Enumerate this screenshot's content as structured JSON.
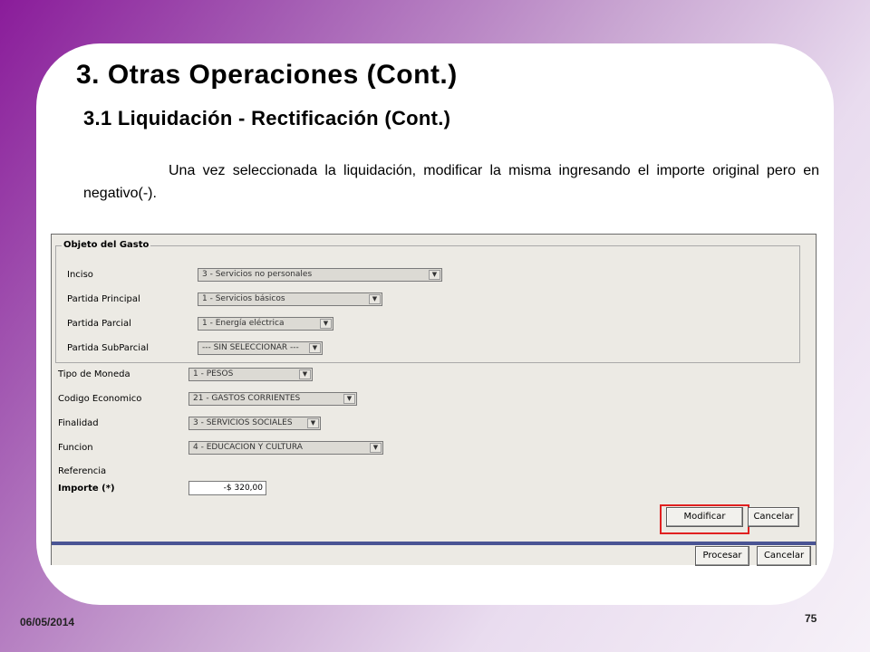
{
  "slide": {
    "title": "3. Otras Operaciones (Cont.)",
    "subtitle": "3.1 Liquidación - Rectificación (Cont.)",
    "paragraph": "Una vez seleccionada la liquidación, modificar la misma ingresando el importe original pero en negativo(-).",
    "date": "06/05/2014",
    "page_number": "75"
  },
  "form": {
    "group_title": "Objeto del Gasto",
    "inciso": {
      "label": "Inciso",
      "value": "3 - Servicios no personales"
    },
    "partida_principal": {
      "label": "Partida Principal",
      "value": "1 - Servicios básicos"
    },
    "partida_parcial": {
      "label": "Partida Parcial",
      "value": "1 - Energía eléctrica"
    },
    "partida_subparcial": {
      "label": "Partida SubParcial",
      "value": "--- SIN SELECCIONAR ---"
    },
    "tipo_moneda": {
      "label": "Tipo de Moneda",
      "value": "1 - PESOS"
    },
    "codigo_economico": {
      "label": "Codigo Economico",
      "value": "21 - GASTOS CORRIENTES"
    },
    "finalidad": {
      "label": "Finalidad",
      "value": "3 - SERVICIOS SOCIALES"
    },
    "funcion": {
      "label": "Funcion",
      "value": "4 - EDUCACION Y CULTURA"
    },
    "referencia": {
      "label": "Referencia"
    },
    "importe": {
      "label": "Importe (*)",
      "value": "-$ 320,00"
    },
    "modificar_label": "Modificar",
    "cancelar_label": "Cancelar",
    "procesar_label": "Procesar",
    "cancelar2_label": "Cancelar",
    "dropdown_arrow": "▼"
  }
}
